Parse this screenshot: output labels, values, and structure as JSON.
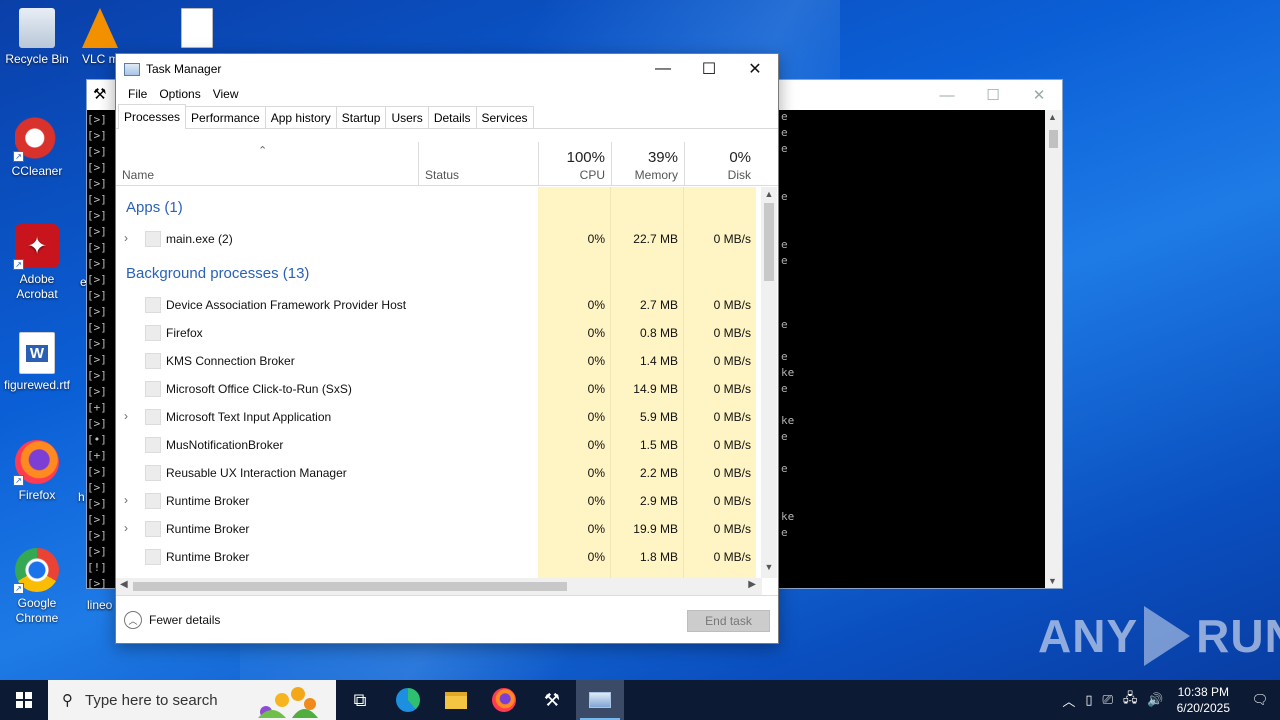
{
  "desktop": {
    "icons": [
      {
        "label": "Recycle Bin",
        "icon": "recycle-bin-icon"
      },
      {
        "label": "VLC m",
        "icon": "vlc-icon"
      },
      {
        "label": "CCleaner",
        "icon": "ccleaner-icon"
      },
      {
        "label": "Adobe Acrobat",
        "icon": "acrobat-icon"
      },
      {
        "label": "figurewed.rtf",
        "icon": "word-doc-icon"
      },
      {
        "label": "Firefox",
        "icon": "firefox-icon"
      },
      {
        "label": "Google Chrome",
        "icon": "chrome-icon"
      }
    ],
    "partial_labels": [
      "e",
      "h",
      "lineo"
    ]
  },
  "console": {
    "prompt_lines": [
      "[>]",
      "[>]",
      "[>]",
      "[>]",
      "[>]",
      "[>]",
      "[>]",
      "[>]",
      "[>]",
      "[>]",
      "[>]",
      "[>]",
      "[>]",
      "[>]",
      "[>]",
      "[>]",
      "[>]",
      "[>]",
      "[+]",
      "[>]",
      "[•]",
      "[+]",
      "[>]",
      "[>]",
      "[>]",
      "[>]",
      "[>]",
      "[>]",
      "[!]",
      "[>]"
    ],
    "right_fragments": [
      "e",
      "e",
      "e",
      "e",
      "e",
      "e",
      "e",
      "e",
      "ke",
      "e",
      "ke",
      "e",
      "e",
      "ke",
      "e"
    ]
  },
  "taskmanager": {
    "title": "Task Manager",
    "menu": [
      "File",
      "Options",
      "View"
    ],
    "tabs": [
      "Processes",
      "Performance",
      "App history",
      "Startup",
      "Users",
      "Details",
      "Services"
    ],
    "active_tab": "Processes",
    "columns": {
      "name": "Name",
      "status": "Status",
      "cpu": {
        "pct": "100%",
        "label": "CPU"
      },
      "memory": {
        "pct": "39%",
        "label": "Memory"
      },
      "disk": {
        "pct": "0%",
        "label": "Disk"
      }
    },
    "groups": {
      "apps": "Apps (1)",
      "background": "Background processes (13)"
    },
    "apps": [
      {
        "name": "main.exe (2)",
        "expandable": true,
        "cpu": "0%",
        "memory": "22.7 MB",
        "disk": "0 MB/s"
      }
    ],
    "background": [
      {
        "name": "Device Association Framework Provider Host",
        "expandable": false,
        "cpu": "0%",
        "memory": "2.7 MB",
        "disk": "0 MB/s"
      },
      {
        "name": "Firefox",
        "expandable": false,
        "cpu": "0%",
        "memory": "0.8 MB",
        "disk": "0 MB/s"
      },
      {
        "name": "KMS Connection Broker",
        "expandable": false,
        "cpu": "0%",
        "memory": "1.4 MB",
        "disk": "0 MB/s"
      },
      {
        "name": "Microsoft Office Click-to-Run (SxS)",
        "expandable": false,
        "cpu": "0%",
        "memory": "14.9 MB",
        "disk": "0 MB/s"
      },
      {
        "name": "Microsoft Text Input Application",
        "expandable": true,
        "cpu": "0%",
        "memory": "5.9 MB",
        "disk": "0 MB/s"
      },
      {
        "name": "MusNotificationBroker",
        "expandable": false,
        "cpu": "0%",
        "memory": "1.5 MB",
        "disk": "0 MB/s"
      },
      {
        "name": "Reusable UX Interaction Manager",
        "expandable": false,
        "cpu": "0%",
        "memory": "2.2 MB",
        "disk": "0 MB/s"
      },
      {
        "name": "Runtime Broker",
        "expandable": true,
        "cpu": "0%",
        "memory": "2.9 MB",
        "disk": "0 MB/s"
      },
      {
        "name": "Runtime Broker",
        "expandable": true,
        "cpu": "0%",
        "memory": "19.9 MB",
        "disk": "0 MB/s"
      },
      {
        "name": "Runtime Broker",
        "expandable": false,
        "cpu": "0%",
        "memory": "1.8 MB",
        "disk": "0 MB/s"
      }
    ],
    "footer": {
      "fewer_details": "Fewer details",
      "end_task": "End task"
    }
  },
  "watermark": {
    "left": "ANY",
    "right": "RUN"
  },
  "taskbar": {
    "search_placeholder": "Type here to search",
    "time": "10:38 PM",
    "date": "6/20/2025",
    "apps": [
      "task-view-icon",
      "edge-icon",
      "file-explorer-icon",
      "firefox-icon",
      "hammer-app-icon",
      "task-manager-icon"
    ]
  },
  "colors": {
    "accent": "#2a62b6",
    "heat": "#fff4c4",
    "taskbar": "#0d1a33"
  }
}
